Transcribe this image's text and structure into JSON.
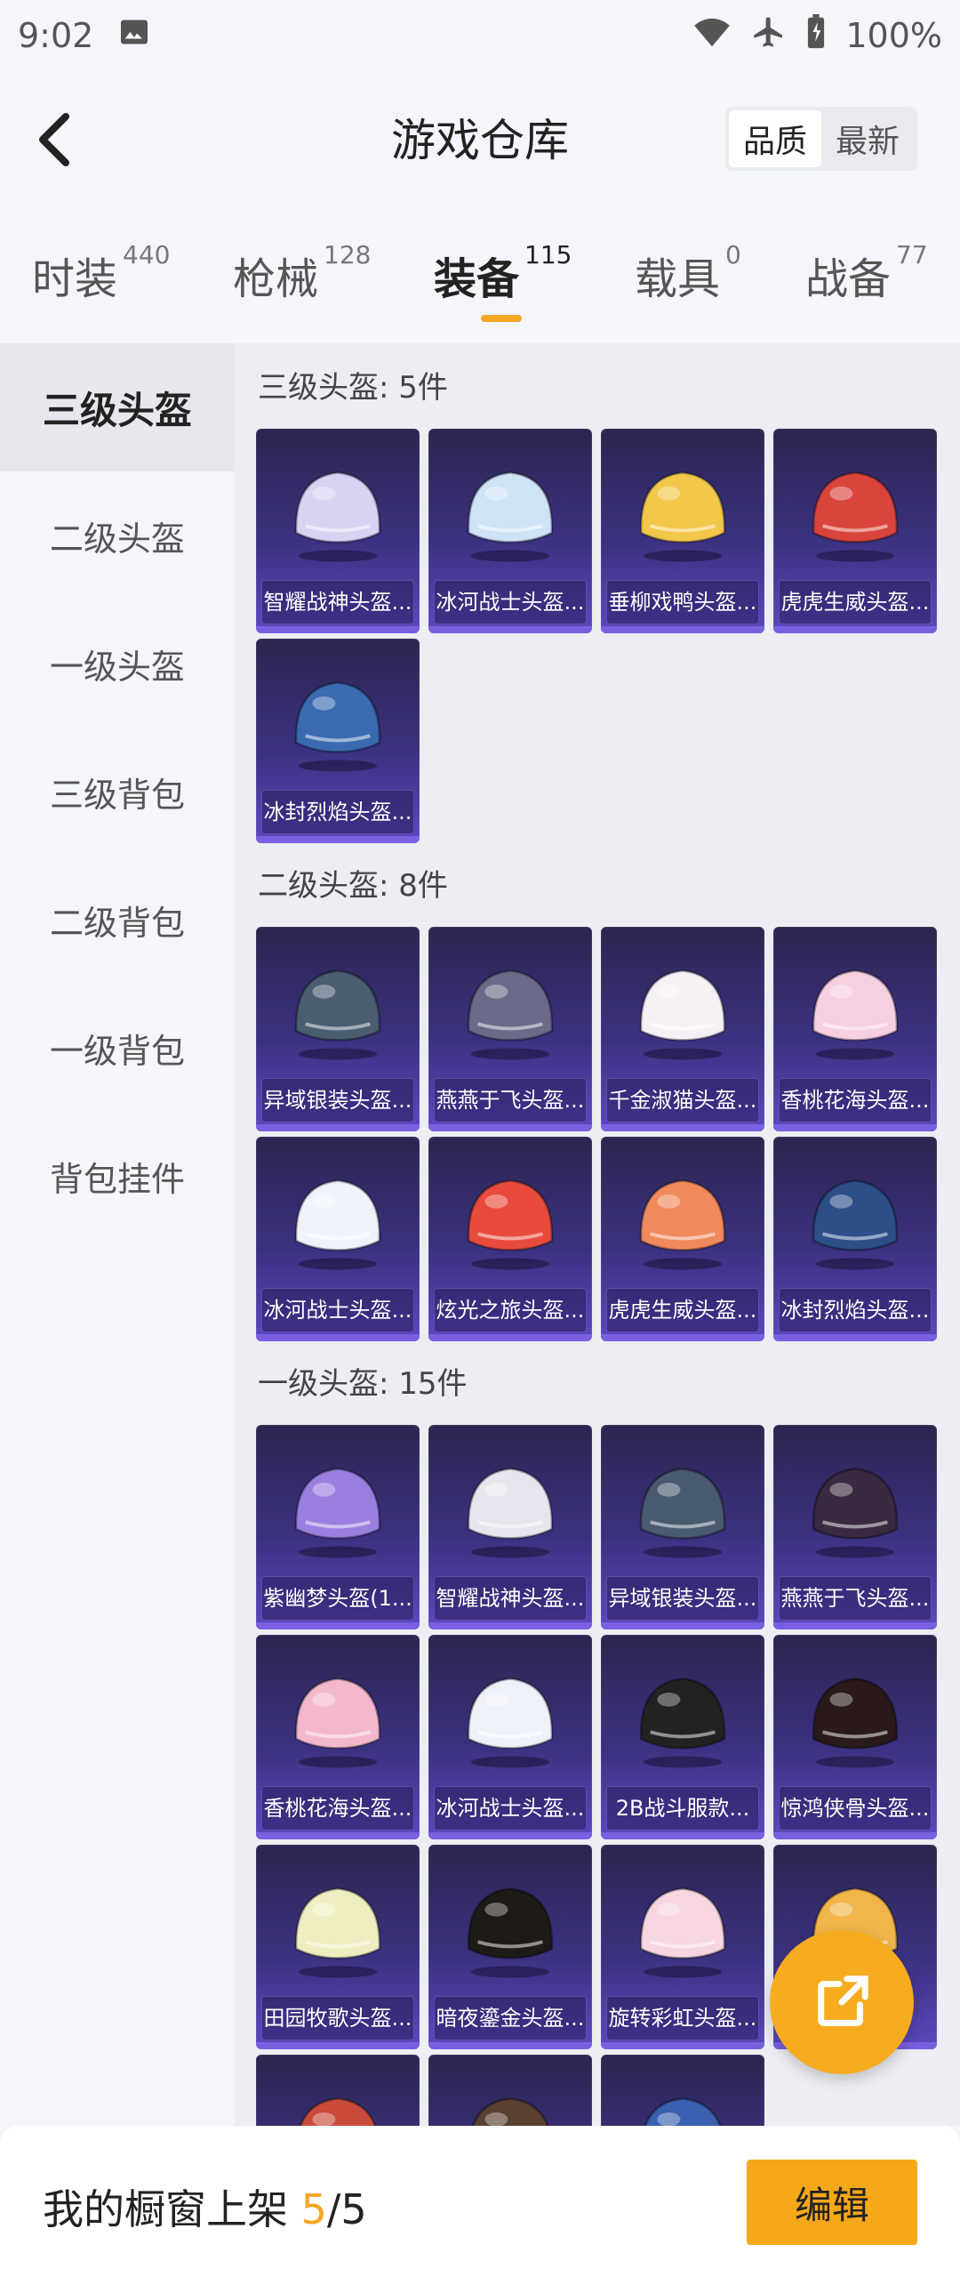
{
  "status": {
    "time": "9:02",
    "battery": "100%"
  },
  "header": {
    "title": "游戏仓库",
    "sort": {
      "options": [
        "品质",
        "最新"
      ],
      "active": "品质"
    }
  },
  "tabs": [
    {
      "label": "时装",
      "count": "440"
    },
    {
      "label": "枪械",
      "count": "128"
    },
    {
      "label": "装备",
      "count": "115",
      "active": true
    },
    {
      "label": "载具",
      "count": "0"
    },
    {
      "label": "战备",
      "count": "77"
    }
  ],
  "sidebar": [
    "三级头盔",
    "二级头盔",
    "一级头盔",
    "三级背包",
    "二级背包",
    "一级背包",
    "背包挂件"
  ],
  "sections": [
    {
      "title": "三级头盔: 5件",
      "items": [
        "智耀战神头盔...",
        "冰河战士头盔...",
        "垂柳戏鸭头盔...",
        "虎虎生威头盔...",
        "冰封烈焰头盔..."
      ]
    },
    {
      "title": "二级头盔: 8件",
      "items": [
        "异域银装头盔...",
        "燕燕于飞头盔...",
        "千金淑猫头盔...",
        "香桃花海头盔...",
        "冰河战士头盔...",
        "炫光之旅头盔...",
        "虎虎生威头盔...",
        "冰封烈焰头盔..."
      ]
    },
    {
      "title": "一级头盔: 15件",
      "items": [
        "紫幽梦头盔(1...",
        "智耀战神头盔...",
        "异域银装头盔...",
        "燕燕于飞头盔...",
        "香桃花海头盔...",
        "冰河战士头盔...",
        "2B战斗服款...",
        "惊鸿侠骨头盔...",
        "田园牧歌头盔...",
        "暗夜鎏金头盔...",
        "旋转彩虹头盔...",
        "",
        "",
        "",
        ""
      ]
    }
  ],
  "bottom": {
    "text": "我的橱窗上架 ",
    "current": "5",
    "total": "/5",
    "edit": "编辑"
  },
  "colors": {
    "accent": "#f5a623",
    "card_dark": "#2c2650",
    "card_light": "#5d48c0"
  }
}
